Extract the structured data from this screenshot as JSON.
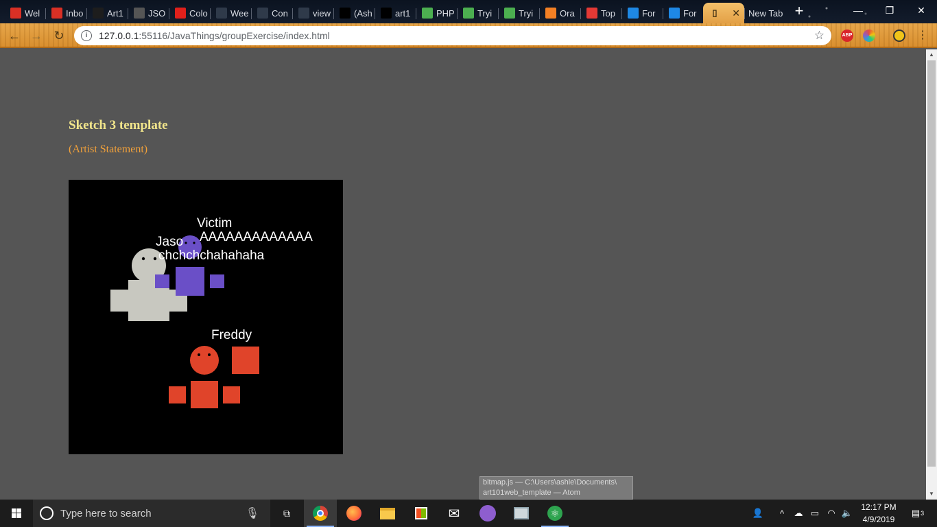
{
  "browser": {
    "tabs": [
      {
        "title": "Wel",
        "icon": "gmail-icon",
        "color": "#d93025"
      },
      {
        "title": "Inbo",
        "icon": "gmail-icon",
        "color": "#d93025"
      },
      {
        "title": "Art1",
        "icon": "s-icon",
        "color": "#1d1d1d"
      },
      {
        "title": "JSO",
        "icon": "braces-icon",
        "color": "#555"
      },
      {
        "title": "Colo",
        "icon": "adobe-icon",
        "color": "#e0201b"
      },
      {
        "title": "Wee",
        "icon": "w-icon",
        "color": "#2f3a4a"
      },
      {
        "title": "Con",
        "icon": "w-icon",
        "color": "#2f3a4a"
      },
      {
        "title": "view",
        "icon": "w-icon",
        "color": "#2f3a4a"
      },
      {
        "title": "(Ash",
        "icon": "face-icon",
        "color": "#000"
      },
      {
        "title": "art1",
        "icon": "face-icon",
        "color": "#000"
      },
      {
        "title": "PHP",
        "icon": "w3-icon",
        "color": "#4caf50"
      },
      {
        "title": "Tryi",
        "icon": "w3-icon",
        "color": "#4caf50"
      },
      {
        "title": "Tryi",
        "icon": "w3-icon",
        "color": "#4caf50"
      },
      {
        "title": "Ora",
        "icon": "r-icon",
        "color": "#f48024"
      },
      {
        "title": "Top",
        "icon": "ring-icon",
        "color": "#e53935"
      },
      {
        "title": "For",
        "icon": "forum-icon",
        "color": "#1e88e5"
      },
      {
        "title": "For",
        "icon": "forum-icon",
        "color": "#1e88e5"
      }
    ],
    "active_tab": {
      "title": "",
      "close": "✕"
    },
    "new_tab_title": "New Tab",
    "new_tab_button": "+",
    "window_controls": {
      "minimize": "—",
      "restore": "❐",
      "close": "✕"
    },
    "url_host": "127.0.0.1",
    "url_rest": ":55116/JavaThings/groupExercise/index.html",
    "extensions": [
      {
        "name": "adblock-icon",
        "label": "ABP",
        "color": "#d9262a"
      },
      {
        "name": "color-picker-icon",
        "label": "",
        "color": "#8e44ad"
      },
      {
        "name": "profile-avatar-icon",
        "label": "",
        "color": "#f0c419"
      }
    ]
  },
  "page": {
    "title": "Sketch 3 template",
    "artist_statement": "(Artist Statement)",
    "colors": {
      "background": "#555555",
      "title": "#f1e58b",
      "statement": "#f2a13a",
      "canvas": "#000000",
      "jason": "#c8c8c0",
      "victim": "#6a4fc7",
      "freddy": "#e0442a"
    },
    "sketch": {
      "victim_label": "Victim",
      "victim_scream": "AAAAAAAAAAAAA",
      "jason_label": "Jaso",
      "jason_laugh": "chchchchahahaha",
      "freddy_label": "Freddy"
    }
  },
  "tooltip": {
    "line1": "bitmap.js — C:\\Users\\ashle\\Documents\\",
    "line2": "art101web_template — Atom"
  },
  "taskbar": {
    "search_placeholder": "Type here to search",
    "time": "12:17 PM",
    "date": "4/9/2019",
    "notifications": "3"
  }
}
